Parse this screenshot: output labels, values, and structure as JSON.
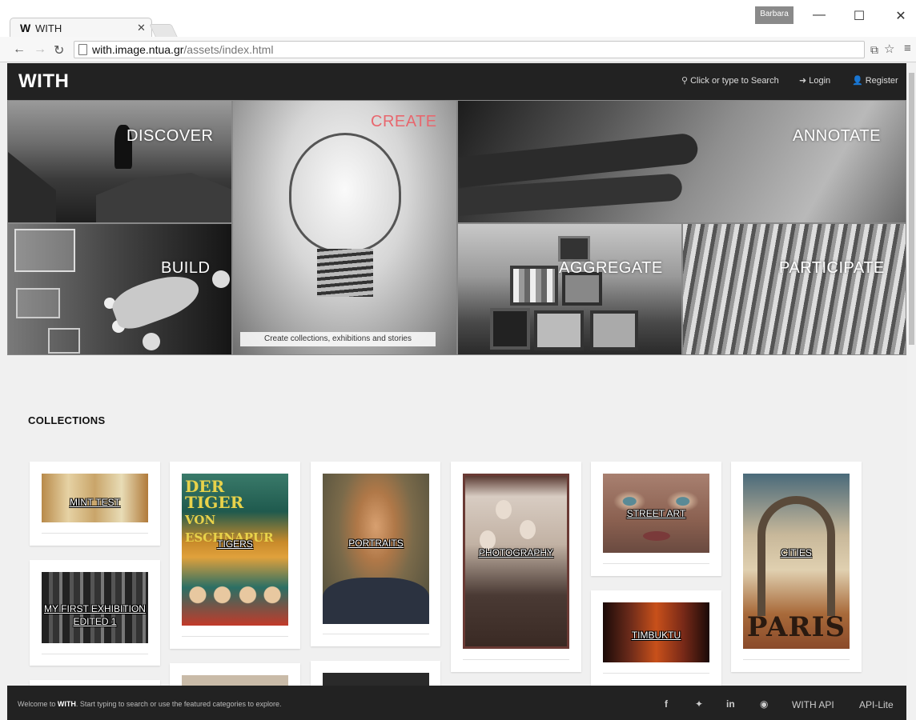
{
  "browser": {
    "tab_title": "WITH",
    "tab_logo": "W",
    "profile_name": "Barbara",
    "url_host": "with.image.ntua.gr",
    "url_path": "/assets/index.html"
  },
  "navbar": {
    "brand": "WITH",
    "search_label": "Click or type to Search",
    "login_label": "Login",
    "register_label": "Register"
  },
  "mosaic": {
    "discover": "DISCOVER",
    "create": "CREATE",
    "annotate": "ANNOTATE",
    "build": "BUILD",
    "aggregate": "AGGREGATE",
    "participate": "PARTICIPATE",
    "create_caption": "Create collections, exhibitions and stories",
    "create_color": "#e8676e"
  },
  "collections": {
    "title": "COLLECTIONS",
    "items": [
      {
        "label": "MINT TEST"
      },
      {
        "label": "TIGERS"
      },
      {
        "label": "PORTRAITS"
      },
      {
        "label": "PHOTOGRAPHY"
      },
      {
        "label": "STREET ART"
      },
      {
        "label": "CITIES"
      },
      {
        "label": "MY FIRST EXHIBITION EDITED 1"
      },
      {
        "label": "TIMBUKTU"
      }
    ]
  },
  "poster": {
    "tiger_line1": "DER TIGER",
    "tiger_line2": "VON ESCHNAPUR",
    "paris": "PARIS"
  },
  "footer": {
    "welcome_prefix": "Welcome to ",
    "welcome_brand": "WITH",
    "welcome_suffix": ". Start typing to search or use the featured categories to explore.",
    "api_label": "WITH API",
    "api_lite_label": "API-Lite"
  }
}
